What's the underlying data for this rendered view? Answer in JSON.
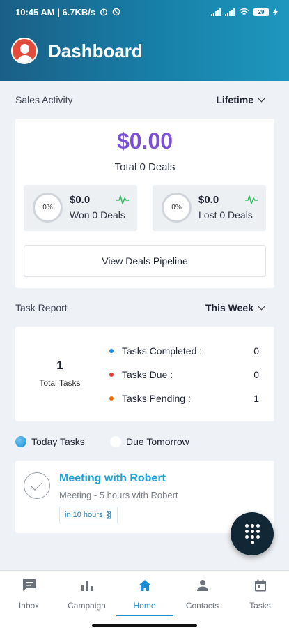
{
  "status_bar": {
    "time_speed": "10:45 AM | 6.7KB/s",
    "battery": "29"
  },
  "header": {
    "title": "Dashboard"
  },
  "sales_activity": {
    "label": "Sales Activity",
    "range": "Lifetime",
    "amount": "$0.00",
    "total_deals": "Total 0 Deals",
    "won": {
      "percent": "0%",
      "value": "$0.0",
      "label": "Won 0 Deals"
    },
    "lost": {
      "percent": "0%",
      "value": "$0.0",
      "label": "Lost 0 Deals"
    },
    "pipeline_button": "View Deals Pipeline"
  },
  "task_report": {
    "label": "Task Report",
    "range": "This Week",
    "total_count": "1",
    "total_label": "Total Tasks",
    "stats": [
      {
        "label": "Tasks Completed :",
        "value": "0",
        "color": "#1e88e5"
      },
      {
        "label": "Tasks Due :",
        "value": "0",
        "color": "#e53935"
      },
      {
        "label": "Tasks Pending :",
        "value": "1",
        "color": "#ef6c00"
      }
    ]
  },
  "tabs": {
    "today": "Today Tasks",
    "tomorrow": "Due Tomorrow"
  },
  "task_item": {
    "title": "Meeting with Robert",
    "subtitle": "Meeting - 5 hours  with Robert",
    "due_badge": "in 10 hours"
  },
  "bottom_nav": {
    "inbox": "Inbox",
    "campaign": "Campaign",
    "home": "Home",
    "contacts": "Contacts",
    "tasks": "Tasks"
  },
  "colors": {
    "accent": "#1d8fd6",
    "amount": "#7b4fd6",
    "header_start": "#1a5f86",
    "header_end": "#1e97be",
    "fab": "#112735"
  }
}
